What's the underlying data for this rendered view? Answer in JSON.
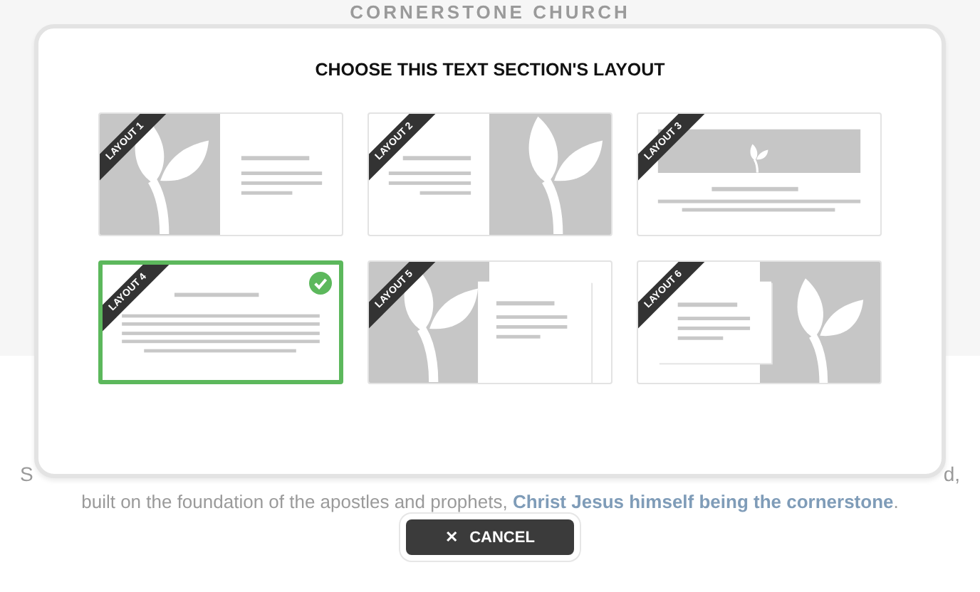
{
  "page": {
    "heading": "CORNERSTONE CHURCH",
    "text_line_1_start": "S",
    "text_line_1_end": "d,",
    "text_line_2": "built on the foundation of the apostles and prophets, **Christ Jesus himself being the cornerstone**."
  },
  "dialog": {
    "title": "CHOOSE THIS TEXT SECTION'S LAYOUT",
    "layouts": [
      {
        "label": "LAYOUT 1",
        "kind": "image-left",
        "selected": false
      },
      {
        "label": "LAYOUT 2",
        "kind": "image-right",
        "selected": false
      },
      {
        "label": "LAYOUT 3",
        "kind": "image-top",
        "selected": false
      },
      {
        "label": "LAYOUT 4",
        "kind": "text-only",
        "selected": true
      },
      {
        "label": "LAYOUT 5",
        "kind": "image-left-overlay",
        "selected": false
      },
      {
        "label": "LAYOUT 6",
        "kind": "image-right-overlay",
        "selected": false
      }
    ]
  },
  "cancel_button": {
    "icon": "✕",
    "label": "CANCEL"
  }
}
